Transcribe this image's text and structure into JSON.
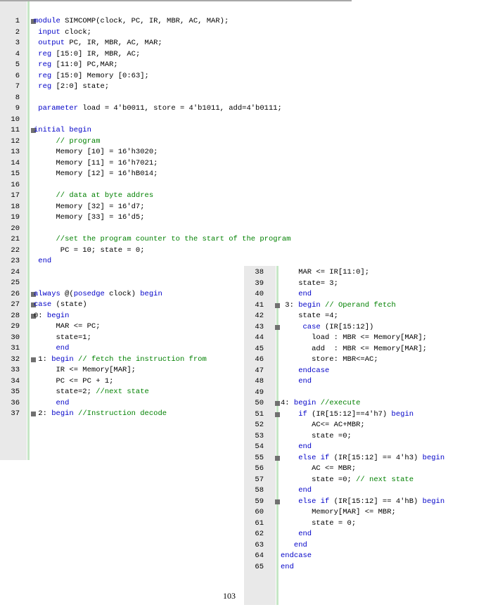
{
  "left_pane": {
    "lines": [
      {
        "num": "1",
        "fold": true,
        "segs": [
          {
            "t": "module",
            "c": "kw"
          },
          {
            "t": " SIMCOMP(clock, PC, IR, MBR, AC, MAR);",
            "c": "tx"
          }
        ]
      },
      {
        "num": "2",
        "fold": false,
        "segs": [
          {
            "t": " input",
            "c": "kw"
          },
          {
            "t": " clock;",
            "c": "tx"
          }
        ]
      },
      {
        "num": "3",
        "fold": false,
        "segs": [
          {
            "t": " output",
            "c": "kw"
          },
          {
            "t": " PC, IR, MBR, AC, MAR;",
            "c": "tx"
          }
        ]
      },
      {
        "num": "4",
        "fold": false,
        "segs": [
          {
            "t": " reg",
            "c": "kw"
          },
          {
            "t": " [15:0] IR, MBR, AC;",
            "c": "tx"
          }
        ]
      },
      {
        "num": "5",
        "fold": false,
        "segs": [
          {
            "t": " reg",
            "c": "kw"
          },
          {
            "t": " [11:0] PC,MAR;",
            "c": "tx"
          }
        ]
      },
      {
        "num": "6",
        "fold": false,
        "segs": [
          {
            "t": " reg",
            "c": "kw"
          },
          {
            "t": " [15:0] Memory [0:63];",
            "c": "tx"
          }
        ]
      },
      {
        "num": "7",
        "fold": false,
        "segs": [
          {
            "t": " reg",
            "c": "kw"
          },
          {
            "t": " [2:0] state;",
            "c": "tx"
          }
        ]
      },
      {
        "num": "8",
        "fold": false,
        "segs": []
      },
      {
        "num": "9",
        "fold": false,
        "segs": [
          {
            "t": " parameter",
            "c": "kw"
          },
          {
            "t": " load = 4'b0011, store = 4'b1011, add=4'b0111;",
            "c": "tx"
          }
        ]
      },
      {
        "num": "10",
        "fold": false,
        "segs": []
      },
      {
        "num": "11",
        "fold": true,
        "segs": [
          {
            "t": "initial begin",
            "c": "kw"
          }
        ]
      },
      {
        "num": "12",
        "fold": false,
        "segs": [
          {
            "t": "     // program",
            "c": "cm"
          }
        ]
      },
      {
        "num": "13",
        "fold": false,
        "segs": [
          {
            "t": "     Memory [10] = 16'h3020;",
            "c": "tx"
          }
        ]
      },
      {
        "num": "14",
        "fold": false,
        "segs": [
          {
            "t": "     Memory [11] = 16'h7021;",
            "c": "tx"
          }
        ]
      },
      {
        "num": "15",
        "fold": false,
        "segs": [
          {
            "t": "     Memory [12] = 16'hB014;",
            "c": "tx"
          }
        ]
      },
      {
        "num": "16",
        "fold": false,
        "segs": []
      },
      {
        "num": "17",
        "fold": false,
        "segs": [
          {
            "t": "     // data at byte addres",
            "c": "cm"
          }
        ]
      },
      {
        "num": "18",
        "fold": false,
        "segs": [
          {
            "t": "     Memory [32] = 16'd7;",
            "c": "tx"
          }
        ]
      },
      {
        "num": "19",
        "fold": false,
        "segs": [
          {
            "t": "     Memory [33] = 16'd5;",
            "c": "tx"
          }
        ]
      },
      {
        "num": "20",
        "fold": false,
        "segs": []
      },
      {
        "num": "21",
        "fold": false,
        "segs": [
          {
            "t": "     //set the program counter to the start of the program",
            "c": "cm"
          }
        ]
      },
      {
        "num": "22",
        "fold": false,
        "segs": [
          {
            "t": "      PC = 10; state = 0;",
            "c": "tx"
          }
        ]
      },
      {
        "num": "23",
        "fold": false,
        "segs": [
          {
            "t": " end",
            "c": "kw"
          }
        ]
      },
      {
        "num": "24",
        "fold": false,
        "segs": []
      },
      {
        "num": "25",
        "fold": false,
        "segs": []
      },
      {
        "num": "26",
        "fold": true,
        "segs": [
          {
            "t": "always",
            "c": "kw"
          },
          {
            "t": " @(",
            "c": "tx"
          },
          {
            "t": "posedge",
            "c": "kw"
          },
          {
            "t": " clock) ",
            "c": "tx"
          },
          {
            "t": "begin",
            "c": "kw"
          }
        ]
      },
      {
        "num": "27",
        "fold": true,
        "segs": [
          {
            "t": "case",
            "c": "kw"
          },
          {
            "t": " (state)",
            "c": "tx"
          }
        ]
      },
      {
        "num": "28",
        "fold": true,
        "segs": [
          {
            "t": "0: ",
            "c": "tx"
          },
          {
            "t": "begin",
            "c": "kw"
          }
        ]
      },
      {
        "num": "29",
        "fold": false,
        "segs": [
          {
            "t": "     MAR <= PC;",
            "c": "tx"
          }
        ]
      },
      {
        "num": "30",
        "fold": false,
        "segs": [
          {
            "t": "     state=1;",
            "c": "tx"
          }
        ]
      },
      {
        "num": "31",
        "fold": false,
        "segs": [
          {
            "t": "     end",
            "c": "kw"
          }
        ]
      },
      {
        "num": "32",
        "fold": true,
        "segs": [
          {
            "t": " 1: ",
            "c": "tx"
          },
          {
            "t": "begin",
            "c": "kw"
          },
          {
            "t": " // fetch the instruction from",
            "c": "cm"
          }
        ]
      },
      {
        "num": "33",
        "fold": false,
        "segs": [
          {
            "t": "     IR <= Memory[MAR];",
            "c": "tx"
          }
        ]
      },
      {
        "num": "34",
        "fold": false,
        "segs": [
          {
            "t": "     PC <= PC + 1;",
            "c": "tx"
          }
        ]
      },
      {
        "num": "35",
        "fold": false,
        "segs": [
          {
            "t": "     state=2; ",
            "c": "tx"
          },
          {
            "t": "//next state",
            "c": "cm"
          }
        ]
      },
      {
        "num": "36",
        "fold": false,
        "segs": [
          {
            "t": "     end",
            "c": "kw"
          }
        ]
      },
      {
        "num": "37",
        "fold": true,
        "segs": [
          {
            "t": " 2: ",
            "c": "tx"
          },
          {
            "t": "begin",
            "c": "kw"
          },
          {
            "t": " //Instruction decode",
            "c": "cm"
          }
        ]
      }
    ]
  },
  "right_pane": {
    "lines": [
      {
        "num": "38",
        "fold": false,
        "segs": [
          {
            "t": "    MAR <= IR[11:0];",
            "c": "tx"
          }
        ]
      },
      {
        "num": "39",
        "fold": false,
        "segs": [
          {
            "t": "    state= 3;",
            "c": "tx"
          }
        ]
      },
      {
        "num": "40",
        "fold": false,
        "segs": [
          {
            "t": "    end",
            "c": "kw"
          }
        ]
      },
      {
        "num": "41",
        "fold": true,
        "segs": [
          {
            "t": " 3: ",
            "c": "tx"
          },
          {
            "t": "begin",
            "c": "kw"
          },
          {
            "t": " // Operand fetch",
            "c": "cm"
          }
        ]
      },
      {
        "num": "42",
        "fold": false,
        "segs": [
          {
            "t": "    state =4;",
            "c": "tx"
          }
        ]
      },
      {
        "num": "43",
        "fold": true,
        "segs": [
          {
            "t": "     case",
            "c": "kw"
          },
          {
            "t": " (IR[15:12])",
            "c": "tx"
          }
        ]
      },
      {
        "num": "44",
        "fold": false,
        "segs": [
          {
            "t": "       load : MBR <= Memory[MAR];",
            "c": "tx"
          }
        ]
      },
      {
        "num": "45",
        "fold": false,
        "segs": [
          {
            "t": "       add  : MBR <= Memory[MAR];",
            "c": "tx"
          }
        ]
      },
      {
        "num": "46",
        "fold": false,
        "segs": [
          {
            "t": "       store: MBR<=AC;",
            "c": "tx"
          }
        ]
      },
      {
        "num": "47",
        "fold": false,
        "segs": [
          {
            "t": "    endcase",
            "c": "kw"
          }
        ]
      },
      {
        "num": "48",
        "fold": false,
        "segs": [
          {
            "t": "    end",
            "c": "kw"
          }
        ]
      },
      {
        "num": "49",
        "fold": false,
        "segs": []
      },
      {
        "num": "50",
        "fold": true,
        "segs": [
          {
            "t": "4: ",
            "c": "tx"
          },
          {
            "t": "begin",
            "c": "kw"
          },
          {
            "t": " //execute",
            "c": "cm"
          }
        ]
      },
      {
        "num": "51",
        "fold": true,
        "segs": [
          {
            "t": "    if",
            "c": "kw"
          },
          {
            "t": " (IR[15:12]==4'h7) ",
            "c": "tx"
          },
          {
            "t": "begin",
            "c": "kw"
          }
        ]
      },
      {
        "num": "52",
        "fold": false,
        "segs": [
          {
            "t": "       AC<= AC+MBR;",
            "c": "tx"
          }
        ]
      },
      {
        "num": "53",
        "fold": false,
        "segs": [
          {
            "t": "       state =0;",
            "c": "tx"
          }
        ]
      },
      {
        "num": "54",
        "fold": false,
        "segs": [
          {
            "t": "    end",
            "c": "kw"
          }
        ]
      },
      {
        "num": "55",
        "fold": true,
        "segs": [
          {
            "t": "    else if",
            "c": "kw"
          },
          {
            "t": " (IR[15:12] == 4'h3) ",
            "c": "tx"
          },
          {
            "t": "begin",
            "c": "kw"
          }
        ]
      },
      {
        "num": "56",
        "fold": false,
        "segs": [
          {
            "t": "       AC <= MBR;",
            "c": "tx"
          }
        ]
      },
      {
        "num": "57",
        "fold": false,
        "segs": [
          {
            "t": "       state =0; ",
            "c": "tx"
          },
          {
            "t": "// next state",
            "c": "cm"
          }
        ]
      },
      {
        "num": "58",
        "fold": false,
        "segs": [
          {
            "t": "    end",
            "c": "kw"
          }
        ]
      },
      {
        "num": "59",
        "fold": true,
        "segs": [
          {
            "t": "    else if",
            "c": "kw"
          },
          {
            "t": " (IR[15:12] == 4'hB) ",
            "c": "tx"
          },
          {
            "t": "begin",
            "c": "kw"
          }
        ]
      },
      {
        "num": "60",
        "fold": false,
        "segs": [
          {
            "t": "       Memory[MAR] <= MBR;",
            "c": "tx"
          }
        ]
      },
      {
        "num": "61",
        "fold": false,
        "segs": [
          {
            "t": "       state = 0;",
            "c": "tx"
          }
        ]
      },
      {
        "num": "62",
        "fold": false,
        "segs": [
          {
            "t": "    end",
            "c": "kw"
          }
        ]
      },
      {
        "num": "63",
        "fold": false,
        "segs": [
          {
            "t": "   end",
            "c": "kw"
          }
        ]
      },
      {
        "num": "64",
        "fold": false,
        "segs": [
          {
            "t": "endcase",
            "c": "kw"
          }
        ]
      },
      {
        "num": "65",
        "fold": false,
        "segs": [
          {
            "t": "end",
            "c": "kw"
          }
        ]
      }
    ]
  },
  "page_number": "103",
  "colors": {
    "keyword": "#0000c8",
    "comment": "#008000",
    "text": "#000000",
    "gutter": "#e9e9e9",
    "change_bar": "#c6e6c6",
    "fold_marker": "#707070"
  }
}
